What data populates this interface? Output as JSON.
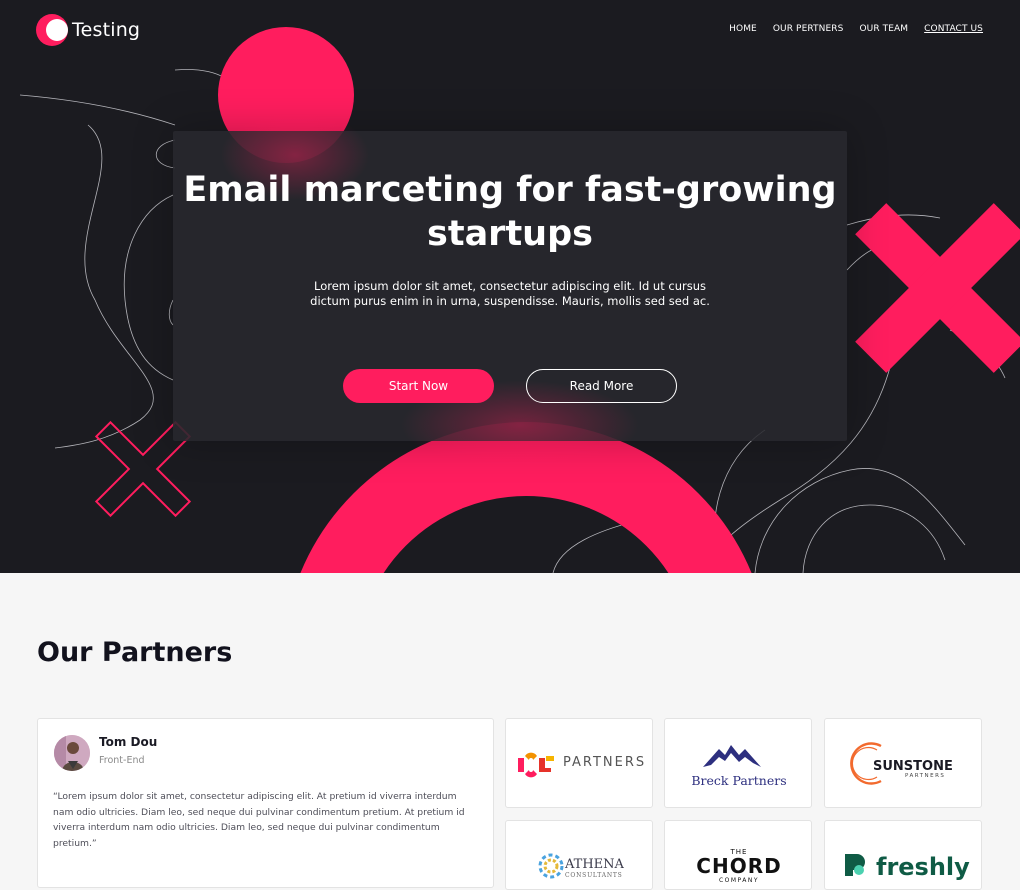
{
  "brand": {
    "name": "Testing",
    "accent": "#ff1d5e"
  },
  "nav": {
    "items": [
      {
        "label": "HOME"
      },
      {
        "label": "OUR PERTNERS"
      },
      {
        "label": "OUR TEAM"
      },
      {
        "label": "CONTACT US"
      }
    ]
  },
  "hero": {
    "title": "Email marceting for fast-growing startups",
    "subtitle": "Lorem ipsum dolor sit amet, consectetur adipiscing elit. Id ut cursus dictum purus enim in in urna, suspendisse. Mauris, mollis sed sed ac.",
    "primary_button": "Start Now",
    "secondary_button": "Read More"
  },
  "partners": {
    "title": "Our Partners",
    "testimonial": {
      "name": "Tom Dou",
      "role": "Front-End",
      "quote": "“Lorem ipsum dolor sit amet, consectetur adipiscing elit. At pretium id viverra interdum nam odio ultricies. Diam leo, sed neque dui pulvinar condimentum pretium. At pretium id viverra interdum nam odio ultricies. Diam leo, sed neque dui pulvinar condimentum pretium.”"
    },
    "logos": {
      "stc": {
        "text": "PARTNERS"
      },
      "breck": {
        "text": "Breck Partners"
      },
      "sunstone": {
        "name": "SUNSTONE",
        "sub": "PARTNERS"
      },
      "athena": {
        "name": "ATHENA",
        "sub": "CONSULTANTS"
      },
      "chord": {
        "top": "THE",
        "name": "CHORD",
        "sub": "COMPANY"
      },
      "freshly": {
        "name": "freshly"
      }
    }
  }
}
